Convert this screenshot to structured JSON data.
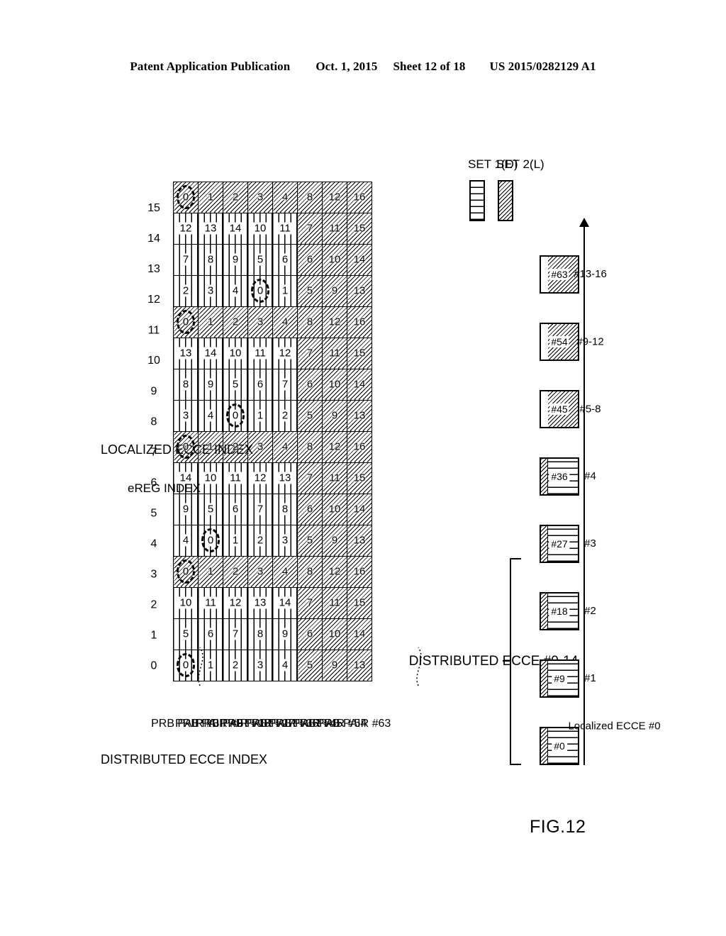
{
  "header": {
    "left": "Patent Application Publication",
    "date": "Oct. 1, 2015",
    "sheet": "Sheet 12 of 18",
    "docnum": "US 2015/0282129 A1"
  },
  "figure": {
    "label": "FIG.12"
  },
  "legend": {
    "items": [
      {
        "label": "SET 1(D)",
        "pattern": "vertical-lines"
      },
      {
        "label": "SET 2(L)",
        "pattern": "diagonal-hatch"
      }
    ]
  },
  "strip": {
    "bracket_label": "DISTRIBUTED ECCE #0-14",
    "axis_label": "Localized ECCE #0",
    "blocks": [
      {
        "id": "#0",
        "set": "distributed",
        "sub": ""
      },
      {
        "id": "#9",
        "set": "distributed",
        "sub": "#1"
      },
      {
        "id": "#18",
        "set": "distributed",
        "sub": "#2"
      },
      {
        "id": "#27",
        "set": "distributed",
        "sub": "#3"
      },
      {
        "id": "#36",
        "set": "distributed",
        "sub": "#4"
      },
      {
        "id": "#45",
        "set": "localized",
        "sub": "#5-8"
      },
      {
        "id": "#54",
        "set": "localized",
        "sub": "#9-12"
      },
      {
        "id": "#63",
        "set": "localized",
        "sub": "#13-16"
      }
    ]
  },
  "table": {
    "col_axis_title": "eREG INDEX",
    "caption_localized": "LOCALIZED ECCE INDEX",
    "caption_distributed": "DISTRIBUTED ECCE INDEX",
    "col_headers": [
      "0",
      "1",
      "2",
      "3",
      "4",
      "5",
      "6",
      "7",
      "8",
      "9",
      "10",
      "11",
      "12",
      "13",
      "14",
      "15"
    ],
    "row_headers": [
      "PRB PAIR #0",
      "PRB PAIR #9",
      "PRB PAIR #18",
      "PRB PAIR #27",
      "PRB PAIR #36",
      "PRB PAIR #45",
      "PRB PAIR #54",
      "PRB PAIR #63"
    ],
    "row_sets": [
      [
        "D",
        "D",
        "D",
        "L",
        "D",
        "D",
        "D",
        "L",
        "D",
        "D",
        "D",
        "L",
        "D",
        "D",
        "D",
        "L"
      ],
      [
        "D",
        "D",
        "D",
        "L",
        "D",
        "D",
        "D",
        "L",
        "D",
        "D",
        "D",
        "L",
        "D",
        "D",
        "D",
        "L"
      ],
      [
        "D",
        "D",
        "D",
        "L",
        "D",
        "D",
        "D",
        "L",
        "D",
        "D",
        "D",
        "L",
        "D",
        "D",
        "D",
        "L"
      ],
      [
        "D",
        "D",
        "D",
        "L",
        "D",
        "D",
        "D",
        "L",
        "D",
        "D",
        "D",
        "L",
        "D",
        "D",
        "D",
        "L"
      ],
      [
        "D",
        "D",
        "D",
        "L",
        "D",
        "D",
        "D",
        "L",
        "D",
        "D",
        "D",
        "L",
        "D",
        "D",
        "D",
        "L"
      ],
      [
        "L",
        "L",
        "L",
        "L",
        "L",
        "L",
        "L",
        "L",
        "L",
        "L",
        "L",
        "L",
        "L",
        "L",
        "L",
        "L"
      ],
      [
        "L",
        "L",
        "L",
        "L",
        "L",
        "L",
        "L",
        "L",
        "L",
        "L",
        "L",
        "L",
        "L",
        "L",
        "L",
        "L"
      ],
      [
        "L",
        "L",
        "L",
        "L",
        "L",
        "L",
        "L",
        "L",
        "L",
        "L",
        "L",
        "L",
        "L",
        "L",
        "L",
        "L"
      ]
    ],
    "values": [
      [
        "0",
        "5",
        "10",
        "0",
        "4",
        "9",
        "14",
        "0",
        "3",
        "8",
        "13",
        "0",
        "2",
        "7",
        "12",
        "0"
      ],
      [
        "1",
        "6",
        "11",
        "1",
        "0",
        "5",
        "10",
        "1",
        "4",
        "9",
        "14",
        "1",
        "3",
        "8",
        "13",
        "1"
      ],
      [
        "2",
        "7",
        "12",
        "2",
        "1",
        "6",
        "11",
        "2",
        "0",
        "5",
        "10",
        "2",
        "4",
        "9",
        "14",
        "2"
      ],
      [
        "3",
        "8",
        "13",
        "3",
        "2",
        "7",
        "12",
        "3",
        "1",
        "6",
        "11",
        "3",
        "0",
        "5",
        "10",
        "3"
      ],
      [
        "4",
        "9",
        "14",
        "4",
        "3",
        "8",
        "13",
        "4",
        "2",
        "7",
        "12",
        "4",
        "1",
        "6",
        "11",
        "4"
      ],
      [
        "5",
        "6",
        "7",
        "8",
        "5",
        "6",
        "7",
        "8",
        "5",
        "6",
        "7",
        "8",
        "5",
        "6",
        "7",
        "8"
      ],
      [
        "9",
        "10",
        "11",
        "12",
        "9",
        "10",
        "11",
        "12",
        "9",
        "10",
        "11",
        "12",
        "9",
        "10",
        "11",
        "12"
      ],
      [
        "13",
        "14",
        "15",
        "16",
        "13",
        "14",
        "15",
        "16",
        "13",
        "14",
        "15",
        "16",
        "13",
        "14",
        "15",
        "16"
      ]
    ],
    "highlighted_cells": [
      {
        "row": 0,
        "col": 0
      },
      {
        "row": 0,
        "col": 3
      },
      {
        "row": 1,
        "col": 4
      },
      {
        "row": 0,
        "col": 7
      },
      {
        "row": 2,
        "col": 8
      },
      {
        "row": 0,
        "col": 11
      },
      {
        "row": 3,
        "col": 12
      },
      {
        "row": 0,
        "col": 15
      }
    ]
  }
}
